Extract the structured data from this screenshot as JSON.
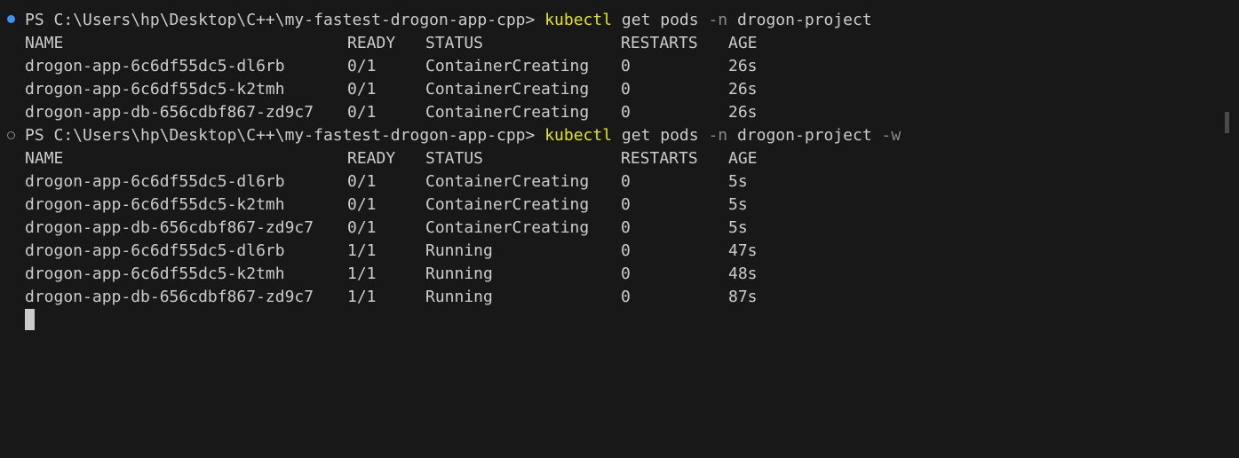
{
  "prompt_prefix": "PS C:\\Users\\hp\\Desktop\\C++\\my-fastest-drogon-app-cpp> ",
  "commands": [
    {
      "cmd": "kubectl",
      "args": " get pods ",
      "flag": "-n",
      "rest": " drogon-project",
      "flag2": ""
    },
    {
      "cmd": "kubectl",
      "args": " get pods ",
      "flag": "-n",
      "rest": " drogon-project ",
      "flag2": "-w"
    }
  ],
  "headers": {
    "name": "NAME",
    "ready": "READY",
    "status": "STATUS",
    "restarts": "RESTARTS",
    "age": "AGE"
  },
  "output1": [
    {
      "name": "drogon-app-6c6df55dc5-dl6rb",
      "ready": "0/1",
      "status": "ContainerCreating",
      "restarts": "0",
      "age": "26s"
    },
    {
      "name": "drogon-app-6c6df55dc5-k2tmh",
      "ready": "0/1",
      "status": "ContainerCreating",
      "restarts": "0",
      "age": "26s"
    },
    {
      "name": "drogon-app-db-656cdbf867-zd9c7",
      "ready": "0/1",
      "status": "ContainerCreating",
      "restarts": "0",
      "age": "26s"
    }
  ],
  "output2": [
    {
      "name": "drogon-app-6c6df55dc5-dl6rb",
      "ready": "0/1",
      "status": "ContainerCreating",
      "restarts": "0",
      "age": "5s"
    },
    {
      "name": "drogon-app-6c6df55dc5-k2tmh",
      "ready": "0/1",
      "status": "ContainerCreating",
      "restarts": "0",
      "age": "5s"
    },
    {
      "name": "drogon-app-db-656cdbf867-zd9c7",
      "ready": "0/1",
      "status": "ContainerCreating",
      "restarts": "0",
      "age": "5s"
    },
    {
      "name": "drogon-app-6c6df55dc5-dl6rb",
      "ready": "1/1",
      "status": "Running",
      "restarts": "0",
      "age": "47s"
    },
    {
      "name": "drogon-app-6c6df55dc5-k2tmh",
      "ready": "1/1",
      "status": "Running",
      "restarts": "0",
      "age": "48s"
    },
    {
      "name": "drogon-app-db-656cdbf867-zd9c7",
      "ready": "1/1",
      "status": "Running",
      "restarts": "0",
      "age": "87s"
    }
  ],
  "colors": {
    "background": "#181818",
    "text": "#cccccc",
    "command": "#e5e510",
    "flag": "#8b8b8b",
    "decoration_success": "#3794ff"
  }
}
